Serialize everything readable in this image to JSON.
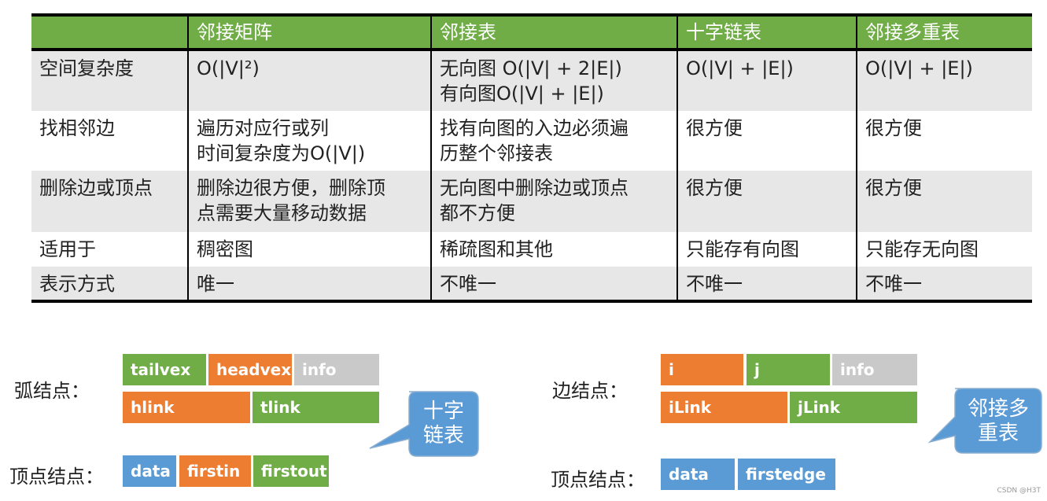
{
  "table": {
    "headers": [
      "",
      "邻接矩阵",
      "邻接表",
      "十字链表",
      "邻接多重表"
    ],
    "rows": [
      {
        "label": "空间复杂度",
        "cells": [
          [
            "O(|V|²)"
          ],
          [
            "无向图 O(|V| + 2|E|)",
            "有向图O(|V| + |E|)"
          ],
          [
            "O(|V| + |E|)"
          ],
          [
            "O(|V| + |E|)"
          ]
        ]
      },
      {
        "label": "找相邻边",
        "cells": [
          [
            "遍历对应行或列",
            "时间复杂度为O(|V|)"
          ],
          [
            "找有向图的入边必须遍",
            "历整个邻接表"
          ],
          [
            "很方便"
          ],
          [
            "很方便"
          ]
        ]
      },
      {
        "label": "删除边或顶点",
        "cells": [
          [
            "删除边很方便，删除顶",
            "点需要大量移动数据"
          ],
          [
            "无向图中删除边或顶点",
            "都不方便"
          ],
          [
            "很方便"
          ],
          [
            "很方便"
          ]
        ]
      },
      {
        "label": "适用于",
        "cells": [
          [
            "稠密图"
          ],
          [
            "稀疏图和其他"
          ],
          [
            "只能存有向图"
          ],
          [
            "只能存无向图"
          ]
        ]
      },
      {
        "label": "表示方式",
        "cells": [
          [
            "唯一"
          ],
          [
            "不唯一"
          ],
          [
            "不唯一"
          ],
          [
            "不唯一"
          ]
        ]
      }
    ],
    "colors": {
      "header_bg": "#70ad47",
      "row_alt_bg": "#e7e7e7"
    }
  },
  "orthogonal_list": {
    "arc_node_label": "弧结点：",
    "arc_node_row1": [
      "tailvex",
      "headvex",
      "info"
    ],
    "arc_node_row2": [
      "hlink",
      "tlink"
    ],
    "vertex_node_label": "顶点结点：",
    "vertex_node_fields": [
      "data",
      "firstin",
      "firstout"
    ],
    "callout": [
      "十字",
      "链表"
    ]
  },
  "adjacency_multilist": {
    "edge_node_label": "边结点：",
    "edge_node_row1": [
      "i",
      "j",
      "info"
    ],
    "edge_node_row2": [
      "iLink",
      "jLink"
    ],
    "vertex_node_label": "顶点结点：",
    "vertex_node_fields": [
      "data",
      "firstedge"
    ],
    "callout": [
      "邻接多",
      "重表"
    ]
  },
  "colors": {
    "green": "#70ad47",
    "orange": "#ed7d31",
    "gray": "#c9c9c9",
    "blue": "#5b9bd5"
  },
  "watermark": "CSDN @H3T"
}
